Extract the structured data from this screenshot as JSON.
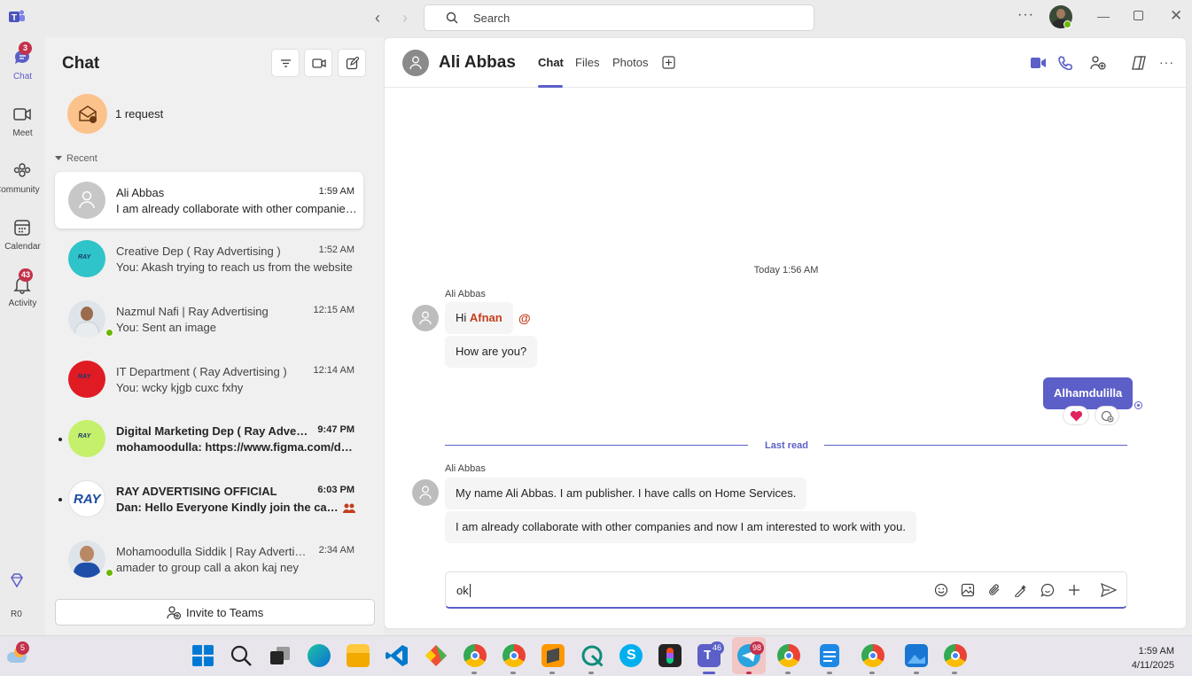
{
  "titlebar": {
    "search_placeholder": "Search",
    "more": "···"
  },
  "rail": {
    "items": [
      {
        "label": "Chat",
        "badge": "3",
        "icon": "chat-icon"
      },
      {
        "label": "Meet",
        "icon": "video-icon"
      },
      {
        "label": "Community",
        "icon": "community-icon"
      },
      {
        "label": "Calendar",
        "icon": "calendar-icon"
      },
      {
        "label": "Activity",
        "badge": "43",
        "icon": "bell-icon"
      }
    ],
    "premium_label": "R0"
  },
  "chat_list": {
    "title": "Chat",
    "request": "1 request",
    "recent_label": "Recent",
    "conversations": [
      {
        "name": "Ali Abbas",
        "time": "1:59 AM",
        "preview": "I am already collaborate with other companies and now I am interested to work with you."
      },
      {
        "name": "Creative Dep ( Ray Advertising )",
        "time": "1:52 AM",
        "preview": "You: Akash trying to reach us from the website"
      },
      {
        "name": "Nazmul Nafi | Ray Advertising",
        "time": "12:15 AM",
        "preview": "You: Sent an image"
      },
      {
        "name": "IT Department ( Ray Advertising )",
        "time": "12:14 AM",
        "preview": "You: wcky kjgb cuxc fxhy"
      },
      {
        "name": "Digital Marketing Dep ( Ray Advertising )",
        "time": "9:47 PM",
        "preview": "mohamoodulla: https://www.figma.com/design"
      },
      {
        "name": "RAY ADVERTISING OFFICIAL",
        "time": "6:03 PM",
        "preview": "Dan: Hello Everyone Kindly join the call now"
      },
      {
        "name": "Mohamoodulla Siddik | Ray Advertising",
        "time": "2:34 AM",
        "preview": "amader to group call a akon kaj ney"
      }
    ],
    "invite_label": "Invite to Teams"
  },
  "chat": {
    "contact_name": "Ali Abbas",
    "tabs": [
      "Chat",
      "Files",
      "Photos"
    ],
    "date_separator": "Today 1:56 AM",
    "group1": {
      "sender": "Ali Abbas",
      "msg1_prefix": "Hi ",
      "msg1_mention": "Afnan",
      "msg2": "How are you?"
    },
    "my_message": "Alhamdulilla",
    "last_read": "Last read",
    "group2": {
      "sender": "Ali Abbas",
      "msg1": "My name Ali Abbas. I am publisher. I have calls on Home Services.",
      "msg2": "I am already collaborate with other companies and now I am interested to work with you."
    },
    "compose_value": "ok"
  },
  "taskbar": {
    "weather_badge": "5",
    "teams_badge": "46",
    "telegram_badge": "98",
    "time": "1:59 AM",
    "date": "4/11/2025"
  },
  "colors": {
    "accent": "#5b5fc7",
    "badge": "#c4314b",
    "mention": "#c43e1c",
    "online": "#6bb700"
  }
}
